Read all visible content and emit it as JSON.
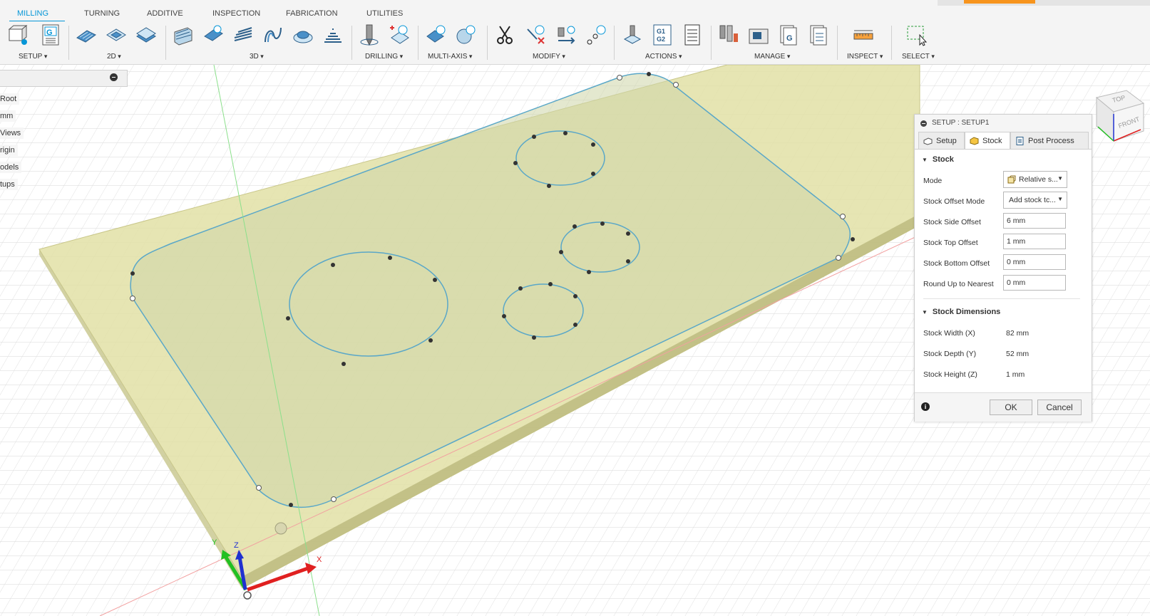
{
  "tabs": [
    "MILLING",
    "TURNING",
    "ADDITIVE",
    "INSPECTION",
    "FABRICATION",
    "UTILITIES"
  ],
  "active_tab": "MILLING",
  "toolbar_groups": {
    "setup": "SETUP",
    "two_d": "2D",
    "three_d": "3D",
    "drilling": "DRILLING",
    "multi_axis": "MULTI-AXIS",
    "modify": "MODIFY",
    "actions": "ACTIONS",
    "manage": "MANAGE",
    "inspect": "INSPECT",
    "select": "SELECT"
  },
  "nc_icon_letter": "G",
  "g1g2_text": [
    "G1",
    "G2"
  ],
  "browser_items": [
    "Root",
    "mm",
    "Views",
    "rigin",
    "odels",
    "tups"
  ],
  "view_cube": {
    "top": "TOP",
    "front": "FRONT"
  },
  "axes": {
    "x": "X",
    "y": "Y",
    "z": "Z"
  },
  "panel": {
    "title": "SETUP : SETUP1",
    "tabs": [
      "Setup",
      "Stock",
      "Post Process"
    ],
    "active_tab": "Stock",
    "stock_section": "Stock",
    "mode_label": "Mode",
    "mode_value": "Relative s...",
    "offset_mode_label": "Stock Offset Mode",
    "offset_mode_value": "Add stock tc...",
    "side_offset_label": "Stock Side Offset",
    "side_offset_value": "6 mm",
    "top_offset_label": "Stock Top Offset",
    "top_offset_value": "1 mm",
    "bottom_offset_label": "Stock Bottom Offset",
    "bottom_offset_value": "0 mm",
    "round_up_label": "Round Up to Nearest",
    "round_up_value": "0 mm",
    "dims_section": "Stock Dimensions",
    "width_label": "Stock Width (X)",
    "width_value": "82 mm",
    "depth_label": "Stock Depth (Y)",
    "depth_value": "52 mm",
    "height_label": "Stock Height (Z)",
    "height_value": "1 mm",
    "ok": "OK",
    "cancel": "Cancel"
  },
  "colors": {
    "accent": "#0696d7",
    "stock_fill": "#e4e2a8",
    "sketch": "#5aa7c8"
  }
}
